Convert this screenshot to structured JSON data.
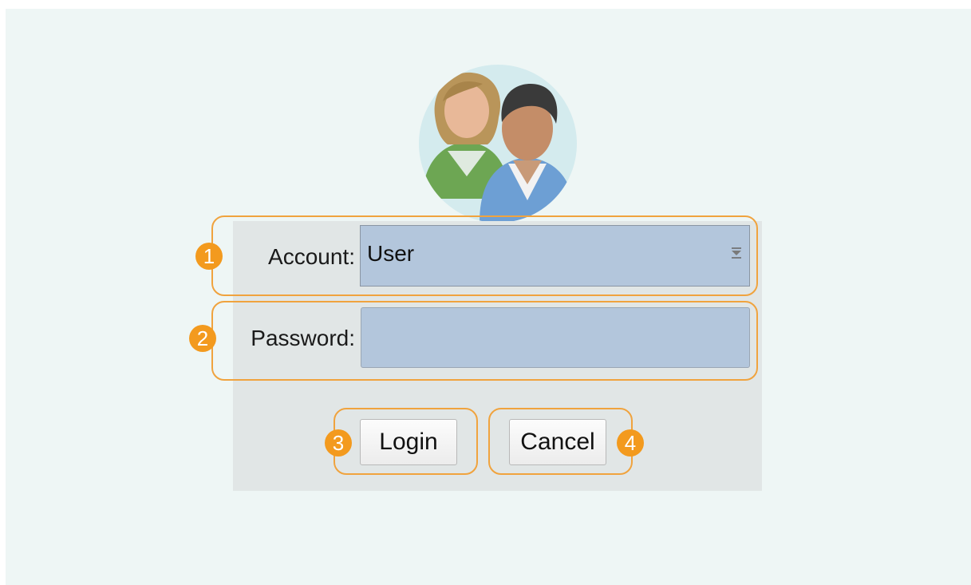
{
  "avatar": {
    "icon": "users-icon"
  },
  "callouts": {
    "one": "1",
    "two": "2",
    "three": "3",
    "four": "4"
  },
  "account": {
    "label": "Account:",
    "value": "User"
  },
  "password": {
    "label": "Password:",
    "value": ""
  },
  "buttons": {
    "login": "Login",
    "cancel": "Cancel"
  },
  "colors": {
    "callout_orange": "#f39a1e",
    "field_fill": "#b3c6dc",
    "panel": "#e1e6e6",
    "background": "#eef6f5"
  }
}
